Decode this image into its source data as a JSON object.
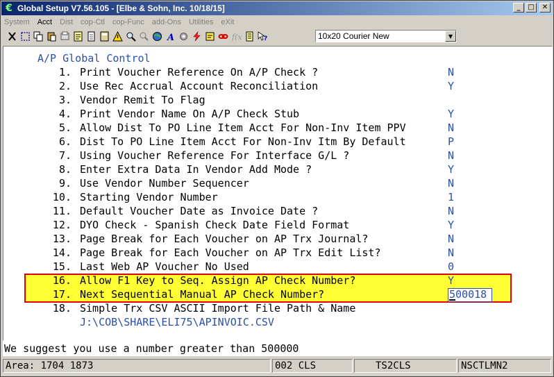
{
  "window": {
    "title": "Global Setup V7.56.105 - [Elbe & Sohn, Inc. 10/18/15]",
    "controls": {
      "minimize": "_",
      "maximize": "□",
      "close": "✕"
    }
  },
  "menu": [
    {
      "label": "System",
      "enabled": false
    },
    {
      "label": "Acct",
      "enabled": true
    },
    {
      "label": "Dist",
      "enabled": false
    },
    {
      "label": "cop-Ctl",
      "enabled": false
    },
    {
      "label": "cop-Func",
      "enabled": false
    },
    {
      "label": "add-Ons",
      "enabled": false
    },
    {
      "label": "Utilities",
      "enabled": false
    },
    {
      "label": "eXit",
      "enabled": false
    }
  ],
  "toolbar": {
    "font_selector": "10x20 Courier New"
  },
  "screen": {
    "heading": "A/P Global Control",
    "items": [
      {
        "num": "1.",
        "label": "Print Voucher Reference On A/P Check ?",
        "value": "N"
      },
      {
        "num": "2.",
        "label": "Use Rec Accrual Account Reconciliation",
        "value": "Y"
      },
      {
        "num": "3.",
        "label": "Vendor Remit To Flag",
        "value": ""
      },
      {
        "num": "4.",
        "label": "Print Vendor Name On A/P Check Stub",
        "value": "Y"
      },
      {
        "num": "5.",
        "label": "Allow Dist To PO Line Item Acct For Non-Inv Item PPV",
        "value": "N"
      },
      {
        "num": "6.",
        "label": "Dist To PO Line Item Acct For Non-Inv Itm By Default",
        "value": "P"
      },
      {
        "num": "7.",
        "label": "Using Voucher Reference For Interface G/L ?",
        "value": "N"
      },
      {
        "num": "8.",
        "label": "Enter Extra Data In Vendor Add Mode ?",
        "value": "Y"
      },
      {
        "num": "9.",
        "label": "Use Vendor Number Sequencer",
        "value": "N"
      },
      {
        "num": "10.",
        "label": "Starting Vendor Number",
        "value": "1"
      },
      {
        "num": "11.",
        "label": "Default Voucher Date as Invoice Date ?",
        "value": "N"
      },
      {
        "num": "12.",
        "label": "DYO Check - Spanish Check Date Field Format",
        "value": "Y"
      },
      {
        "num": "13.",
        "label": "Page Break for Each Voucher on AP Trx Journal?",
        "value": "N"
      },
      {
        "num": "14.",
        "label": "Page Break for Each Voucher on AP Trx Edit List?",
        "value": "N"
      },
      {
        "num": "15.",
        "label": "Last Web AP Voucher No Used",
        "value": "0"
      },
      {
        "num": "16.",
        "label": "Allow F1 Key to Seq. Assign AP Check Number?",
        "value": "Y"
      },
      {
        "num": "17.",
        "label": "Next Sequential Manual AP Check Number?",
        "value": "500018"
      },
      {
        "num": "18.",
        "label": "Simple Trx CSV ASCII Import File Path & Name",
        "value": ""
      }
    ],
    "path_value": "J:\\COB\\SHARE\\ELI75\\APINVOIC.CSV"
  },
  "message": "We suggest you use a number greater than 500000",
  "status": {
    "area": "Area: 1704 1873",
    "code": "002 CLS",
    "screen_id": "TS2CLS",
    "program": "NSCTLMN2"
  },
  "colors": {
    "highlight": "#ffff33",
    "highlight_border": "#e00000",
    "terminal_text": "#2a4fa8",
    "titlebar": "#0a246a"
  }
}
